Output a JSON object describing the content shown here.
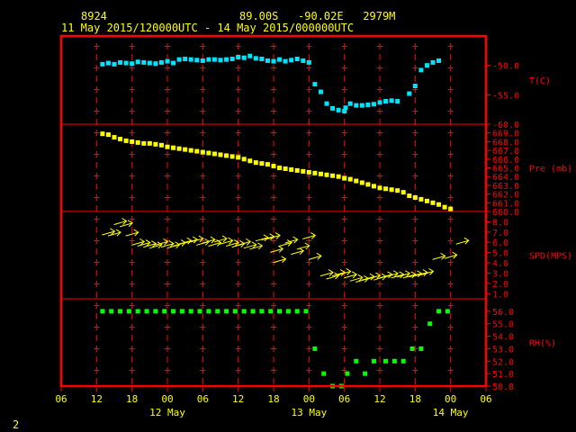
{
  "header": {
    "station": "8924",
    "location": "89.00S   -90.02E   2979M",
    "time_range": "11 May 2015/120000UTC - 14 May 2015/000000UTC"
  },
  "footer": {
    "page_number": "2"
  },
  "colors": {
    "frame": "#ff0000",
    "header": "#ffff00",
    "axis_text": "#ffff00",
    "panel_text": "#ff0000",
    "temp": "#00e5ff",
    "pres": "#ffff00",
    "wind": "#ffff00",
    "rh": "#00ff00",
    "background": "#000000"
  },
  "chart_data": {
    "type": "scatter",
    "x_axis": {
      "unit": "hours from 11 May 2015 00 UTC",
      "range": [
        6,
        78
      ],
      "ticks": [
        {
          "x": 6,
          "label": "06"
        },
        {
          "x": 12,
          "label": "12"
        },
        {
          "x": 18,
          "label": "18"
        },
        {
          "x": 24,
          "label": "00"
        },
        {
          "x": 30,
          "label": "06"
        },
        {
          "x": 36,
          "label": "12"
        },
        {
          "x": 42,
          "label": "18"
        },
        {
          "x": 48,
          "label": "00"
        },
        {
          "x": 54,
          "label": "06"
        },
        {
          "x": 60,
          "label": "12"
        },
        {
          "x": 66,
          "label": "18"
        },
        {
          "x": 72,
          "label": "00"
        },
        {
          "x": 78,
          "label": "06"
        }
      ],
      "day_labels": [
        {
          "x": 24,
          "label": "12 May"
        },
        {
          "x": 48,
          "label": "13 May"
        },
        {
          "x": 72,
          "label": "14 May"
        }
      ]
    },
    "panels": [
      {
        "name": "T(C)",
        "type": "scatter",
        "color": "#00e5ff",
        "ylim": [
          -60,
          -45
        ],
        "ticks": [
          {
            "y": -50,
            "label": "-50.0"
          },
          {
            "y": -55,
            "label": "-55.0"
          },
          {
            "y": -60,
            "label": "-60.0"
          }
        ],
        "points": [
          [
            13,
            -49.8
          ],
          [
            14,
            -49.6
          ],
          [
            15,
            -49.8
          ],
          [
            16,
            -49.5
          ],
          [
            17,
            -49.6
          ],
          [
            18,
            -49.7
          ],
          [
            19,
            -49.4
          ],
          [
            20,
            -49.5
          ],
          [
            21,
            -49.6
          ],
          [
            22,
            -49.7
          ],
          [
            23,
            -49.5
          ],
          [
            24,
            -49.3
          ],
          [
            25,
            -49.6
          ],
          [
            26,
            -49.0
          ],
          [
            27,
            -48.9
          ],
          [
            28,
            -49.0
          ],
          [
            29,
            -49.1
          ],
          [
            30,
            -49.2
          ],
          [
            31,
            -49.0
          ],
          [
            32,
            -49.0
          ],
          [
            33,
            -49.1
          ],
          [
            34,
            -49.0
          ],
          [
            35,
            -48.9
          ],
          [
            36,
            -48.6
          ],
          [
            37,
            -48.7
          ],
          [
            38,
            -48.4
          ],
          [
            39,
            -48.8
          ],
          [
            40,
            -48.9
          ],
          [
            41,
            -49.2
          ],
          [
            42,
            -49.3
          ],
          [
            43,
            -49.0
          ],
          [
            44,
            -49.3
          ],
          [
            45,
            -49.1
          ],
          [
            46,
            -48.9
          ],
          [
            47,
            -49.2
          ],
          [
            48,
            -49.5
          ],
          [
            49,
            -53.2
          ],
          [
            50,
            -54.5
          ],
          [
            51,
            -56.5
          ],
          [
            52,
            -57.3
          ],
          [
            53,
            -57.6
          ],
          [
            54,
            -57.8
          ],
          [
            54.2,
            -57.2
          ],
          [
            55,
            -56.5
          ],
          [
            56,
            -56.8
          ],
          [
            57,
            -56.8
          ],
          [
            58,
            -56.7
          ],
          [
            59,
            -56.6
          ],
          [
            60,
            -56.3
          ],
          [
            61,
            -56.1
          ],
          [
            62,
            -56.0
          ],
          [
            63,
            -56.1
          ],
          [
            65,
            -54.8
          ],
          [
            66,
            -53.5
          ],
          [
            67,
            -50.8
          ],
          [
            68,
            -50.0
          ],
          [
            69,
            -49.5
          ],
          [
            70,
            -49.2
          ]
        ]
      },
      {
        "name": "Pre (mb)",
        "type": "scatter",
        "color": "#ffff00",
        "ylim": [
          660,
          670
        ],
        "ticks": [
          {
            "y": 669,
            "label": "669.0"
          },
          {
            "y": 668,
            "label": "668.0"
          },
          {
            "y": 667,
            "label": "667.0"
          },
          {
            "y": 666,
            "label": "666.0"
          },
          {
            "y": 665,
            "label": "665.0"
          },
          {
            "y": 664,
            "label": "664.0"
          },
          {
            "y": 663,
            "label": "663.0"
          },
          {
            "y": 662,
            "label": "662.0"
          },
          {
            "y": 661,
            "label": "661.0"
          },
          {
            "y": 660,
            "label": "660.0"
          }
        ],
        "points": [
          [
            13,
            668.9
          ],
          [
            14,
            668.8
          ],
          [
            15,
            668.5
          ],
          [
            16,
            668.3
          ],
          [
            17,
            668.1
          ],
          [
            18,
            668.0
          ],
          [
            19,
            667.9
          ],
          [
            20,
            667.8
          ],
          [
            21,
            667.8
          ],
          [
            22,
            667.7
          ],
          [
            23,
            667.6
          ],
          [
            24,
            667.4
          ],
          [
            25,
            667.3
          ],
          [
            26,
            667.2
          ],
          [
            27,
            667.1
          ],
          [
            28,
            667.0
          ],
          [
            29,
            666.9
          ],
          [
            30,
            666.8
          ],
          [
            31,
            666.7
          ],
          [
            32,
            666.6
          ],
          [
            33,
            666.5
          ],
          [
            34,
            666.4
          ],
          [
            35,
            666.3
          ],
          [
            36,
            666.2
          ],
          [
            37,
            666.0
          ],
          [
            38,
            665.8
          ],
          [
            39,
            665.6
          ],
          [
            40,
            665.5
          ],
          [
            41,
            665.4
          ],
          [
            42,
            665.2
          ],
          [
            43,
            665.0
          ],
          [
            44,
            664.9
          ],
          [
            45,
            664.8
          ],
          [
            46,
            664.7
          ],
          [
            47,
            664.6
          ],
          [
            48,
            664.5
          ],
          [
            49,
            664.4
          ],
          [
            50,
            664.3
          ],
          [
            51,
            664.2
          ],
          [
            52,
            664.1
          ],
          [
            53,
            664.0
          ],
          [
            54,
            663.8
          ],
          [
            55,
            663.7
          ],
          [
            56,
            663.5
          ],
          [
            57,
            663.3
          ],
          [
            58,
            663.1
          ],
          [
            59,
            662.9
          ],
          [
            60,
            662.7
          ],
          [
            61,
            662.6
          ],
          [
            62,
            662.5
          ],
          [
            63,
            662.4
          ],
          [
            64,
            662.2
          ],
          [
            65,
            661.8
          ],
          [
            66,
            661.6
          ],
          [
            67,
            661.4
          ],
          [
            68,
            661.2
          ],
          [
            69,
            661.0
          ],
          [
            70,
            660.8
          ],
          [
            71,
            660.5
          ],
          [
            72,
            660.3
          ]
        ]
      },
      {
        "name": "SPD(MPS)",
        "type": "vector",
        "color": "#ffff00",
        "ylim": [
          0.5,
          9
        ],
        "ticks": [
          {
            "y": 8,
            "label": "8.0"
          },
          {
            "y": 7,
            "label": "7.0"
          },
          {
            "y": 6,
            "label": "6.0"
          },
          {
            "y": 5,
            "label": "5.0"
          },
          {
            "y": 4,
            "label": "4.0"
          },
          {
            "y": 3,
            "label": "3.0"
          },
          {
            "y": 2,
            "label": "2.0"
          },
          {
            "y": 1,
            "label": "1.0"
          }
        ],
        "points": [
          [
            14,
            6.9
          ],
          [
            15,
            6.8
          ],
          [
            16,
            7.9
          ],
          [
            17,
            7.7
          ],
          [
            18,
            6.8
          ],
          [
            19,
            5.9
          ],
          [
            20,
            5.8
          ],
          [
            21,
            5.7
          ],
          [
            22,
            5.6
          ],
          [
            23,
            5.9
          ],
          [
            24,
            5.7
          ],
          [
            25,
            5.6
          ],
          [
            26,
            5.8
          ],
          [
            27,
            6.0
          ],
          [
            28,
            6.1
          ],
          [
            29,
            6.2
          ],
          [
            30,
            5.9
          ],
          [
            31,
            6.1
          ],
          [
            32,
            5.8
          ],
          [
            33,
            6.2
          ],
          [
            34,
            6.0
          ],
          [
            35,
            5.8
          ],
          [
            36,
            5.7
          ],
          [
            37,
            5.9
          ],
          [
            38,
            5.6
          ],
          [
            39,
            5.5
          ],
          [
            40,
            6.3
          ],
          [
            41,
            6.4
          ],
          [
            42,
            6.5
          ],
          [
            42.5,
            5.2
          ],
          [
            43,
            4.2
          ],
          [
            44,
            5.8
          ],
          [
            45,
            6.1
          ],
          [
            46,
            5.0
          ],
          [
            47,
            5.5
          ],
          [
            48,
            6.5
          ],
          [
            49,
            4.5
          ],
          [
            51,
            2.9
          ],
          [
            52,
            2.6
          ],
          [
            53,
            2.9
          ],
          [
            54,
            3.0
          ],
          [
            55,
            2.7
          ],
          [
            56,
            2.4
          ],
          [
            57,
            2.3
          ],
          [
            58,
            2.5
          ],
          [
            59,
            2.6
          ],
          [
            60,
            2.5
          ],
          [
            61,
            2.7
          ],
          [
            62,
            2.8
          ],
          [
            63,
            2.7
          ],
          [
            64,
            2.8
          ],
          [
            65,
            2.7
          ],
          [
            66,
            2.8
          ],
          [
            67,
            2.9
          ],
          [
            68,
            3.0
          ],
          [
            70,
            4.5
          ],
          [
            72,
            4.6
          ],
          [
            74,
            6.0
          ]
        ]
      },
      {
        "name": "RH(%)",
        "type": "scatter",
        "color": "#00ff00",
        "ylim": [
          50,
          57
        ],
        "ticks": [
          {
            "y": 56,
            "label": "56.0"
          },
          {
            "y": 55,
            "label": "55.0"
          },
          {
            "y": 54,
            "label": "54.0"
          },
          {
            "y": 53,
            "label": "53.0"
          },
          {
            "y": 52,
            "label": "52.0"
          },
          {
            "y": 51,
            "label": "51.0"
          },
          {
            "y": 50,
            "label": "50.0"
          }
        ],
        "points": [
          [
            13,
            56
          ],
          [
            14.5,
            56
          ],
          [
            16,
            56
          ],
          [
            17.5,
            56
          ],
          [
            19,
            56
          ],
          [
            20.5,
            56
          ],
          [
            22,
            56
          ],
          [
            23.5,
            56
          ],
          [
            25,
            56
          ],
          [
            26.5,
            56
          ],
          [
            28,
            56
          ],
          [
            29.5,
            56
          ],
          [
            31,
            56
          ],
          [
            32.5,
            56
          ],
          [
            34,
            56
          ],
          [
            35.5,
            56
          ],
          [
            37,
            56
          ],
          [
            38.5,
            56
          ],
          [
            40,
            56
          ],
          [
            41.5,
            56
          ],
          [
            43,
            56
          ],
          [
            44.5,
            56
          ],
          [
            46,
            56
          ],
          [
            47.5,
            56
          ],
          [
            49,
            53
          ],
          [
            50.5,
            51
          ],
          [
            52,
            50
          ],
          [
            53.5,
            50
          ],
          [
            54.5,
            51
          ],
          [
            56,
            52
          ],
          [
            57.5,
            51
          ],
          [
            59,
            52
          ],
          [
            61,
            52
          ],
          [
            62.5,
            52
          ],
          [
            64,
            52
          ],
          [
            65.5,
            53
          ],
          [
            67,
            53
          ],
          [
            68.5,
            55
          ],
          [
            70,
            56
          ],
          [
            71.5,
            56
          ]
        ]
      }
    ]
  }
}
